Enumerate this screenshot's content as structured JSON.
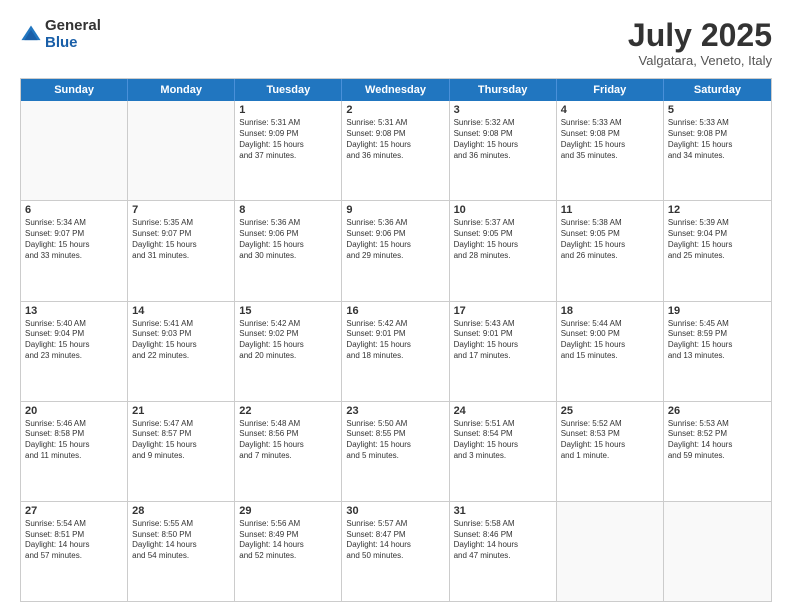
{
  "logo": {
    "general": "General",
    "blue": "Blue"
  },
  "title": "July 2025",
  "subtitle": "Valgatara, Veneto, Italy",
  "header": {
    "days": [
      "Sunday",
      "Monday",
      "Tuesday",
      "Wednesday",
      "Thursday",
      "Friday",
      "Saturday"
    ]
  },
  "weeks": [
    [
      {
        "day": "",
        "empty": true,
        "lines": []
      },
      {
        "day": "",
        "empty": true,
        "lines": []
      },
      {
        "day": "1",
        "empty": false,
        "lines": [
          "Sunrise: 5:31 AM",
          "Sunset: 9:09 PM",
          "Daylight: 15 hours",
          "and 37 minutes."
        ]
      },
      {
        "day": "2",
        "empty": false,
        "lines": [
          "Sunrise: 5:31 AM",
          "Sunset: 9:08 PM",
          "Daylight: 15 hours",
          "and 36 minutes."
        ]
      },
      {
        "day": "3",
        "empty": false,
        "lines": [
          "Sunrise: 5:32 AM",
          "Sunset: 9:08 PM",
          "Daylight: 15 hours",
          "and 36 minutes."
        ]
      },
      {
        "day": "4",
        "empty": false,
        "lines": [
          "Sunrise: 5:33 AM",
          "Sunset: 9:08 PM",
          "Daylight: 15 hours",
          "and 35 minutes."
        ]
      },
      {
        "day": "5",
        "empty": false,
        "lines": [
          "Sunrise: 5:33 AM",
          "Sunset: 9:08 PM",
          "Daylight: 15 hours",
          "and 34 minutes."
        ]
      }
    ],
    [
      {
        "day": "6",
        "empty": false,
        "lines": [
          "Sunrise: 5:34 AM",
          "Sunset: 9:07 PM",
          "Daylight: 15 hours",
          "and 33 minutes."
        ]
      },
      {
        "day": "7",
        "empty": false,
        "lines": [
          "Sunrise: 5:35 AM",
          "Sunset: 9:07 PM",
          "Daylight: 15 hours",
          "and 31 minutes."
        ]
      },
      {
        "day": "8",
        "empty": false,
        "lines": [
          "Sunrise: 5:36 AM",
          "Sunset: 9:06 PM",
          "Daylight: 15 hours",
          "and 30 minutes."
        ]
      },
      {
        "day": "9",
        "empty": false,
        "lines": [
          "Sunrise: 5:36 AM",
          "Sunset: 9:06 PM",
          "Daylight: 15 hours",
          "and 29 minutes."
        ]
      },
      {
        "day": "10",
        "empty": false,
        "lines": [
          "Sunrise: 5:37 AM",
          "Sunset: 9:05 PM",
          "Daylight: 15 hours",
          "and 28 minutes."
        ]
      },
      {
        "day": "11",
        "empty": false,
        "lines": [
          "Sunrise: 5:38 AM",
          "Sunset: 9:05 PM",
          "Daylight: 15 hours",
          "and 26 minutes."
        ]
      },
      {
        "day": "12",
        "empty": false,
        "lines": [
          "Sunrise: 5:39 AM",
          "Sunset: 9:04 PM",
          "Daylight: 15 hours",
          "and 25 minutes."
        ]
      }
    ],
    [
      {
        "day": "13",
        "empty": false,
        "lines": [
          "Sunrise: 5:40 AM",
          "Sunset: 9:04 PM",
          "Daylight: 15 hours",
          "and 23 minutes."
        ]
      },
      {
        "day": "14",
        "empty": false,
        "lines": [
          "Sunrise: 5:41 AM",
          "Sunset: 9:03 PM",
          "Daylight: 15 hours",
          "and 22 minutes."
        ]
      },
      {
        "day": "15",
        "empty": false,
        "lines": [
          "Sunrise: 5:42 AM",
          "Sunset: 9:02 PM",
          "Daylight: 15 hours",
          "and 20 minutes."
        ]
      },
      {
        "day": "16",
        "empty": false,
        "lines": [
          "Sunrise: 5:42 AM",
          "Sunset: 9:01 PM",
          "Daylight: 15 hours",
          "and 18 minutes."
        ]
      },
      {
        "day": "17",
        "empty": false,
        "lines": [
          "Sunrise: 5:43 AM",
          "Sunset: 9:01 PM",
          "Daylight: 15 hours",
          "and 17 minutes."
        ]
      },
      {
        "day": "18",
        "empty": false,
        "lines": [
          "Sunrise: 5:44 AM",
          "Sunset: 9:00 PM",
          "Daylight: 15 hours",
          "and 15 minutes."
        ]
      },
      {
        "day": "19",
        "empty": false,
        "lines": [
          "Sunrise: 5:45 AM",
          "Sunset: 8:59 PM",
          "Daylight: 15 hours",
          "and 13 minutes."
        ]
      }
    ],
    [
      {
        "day": "20",
        "empty": false,
        "lines": [
          "Sunrise: 5:46 AM",
          "Sunset: 8:58 PM",
          "Daylight: 15 hours",
          "and 11 minutes."
        ]
      },
      {
        "day": "21",
        "empty": false,
        "lines": [
          "Sunrise: 5:47 AM",
          "Sunset: 8:57 PM",
          "Daylight: 15 hours",
          "and 9 minutes."
        ]
      },
      {
        "day": "22",
        "empty": false,
        "lines": [
          "Sunrise: 5:48 AM",
          "Sunset: 8:56 PM",
          "Daylight: 15 hours",
          "and 7 minutes."
        ]
      },
      {
        "day": "23",
        "empty": false,
        "lines": [
          "Sunrise: 5:50 AM",
          "Sunset: 8:55 PM",
          "Daylight: 15 hours",
          "and 5 minutes."
        ]
      },
      {
        "day": "24",
        "empty": false,
        "lines": [
          "Sunrise: 5:51 AM",
          "Sunset: 8:54 PM",
          "Daylight: 15 hours",
          "and 3 minutes."
        ]
      },
      {
        "day": "25",
        "empty": false,
        "lines": [
          "Sunrise: 5:52 AM",
          "Sunset: 8:53 PM",
          "Daylight: 15 hours",
          "and 1 minute."
        ]
      },
      {
        "day": "26",
        "empty": false,
        "lines": [
          "Sunrise: 5:53 AM",
          "Sunset: 8:52 PM",
          "Daylight: 14 hours",
          "and 59 minutes."
        ]
      }
    ],
    [
      {
        "day": "27",
        "empty": false,
        "lines": [
          "Sunrise: 5:54 AM",
          "Sunset: 8:51 PM",
          "Daylight: 14 hours",
          "and 57 minutes."
        ]
      },
      {
        "day": "28",
        "empty": false,
        "lines": [
          "Sunrise: 5:55 AM",
          "Sunset: 8:50 PM",
          "Daylight: 14 hours",
          "and 54 minutes."
        ]
      },
      {
        "day": "29",
        "empty": false,
        "lines": [
          "Sunrise: 5:56 AM",
          "Sunset: 8:49 PM",
          "Daylight: 14 hours",
          "and 52 minutes."
        ]
      },
      {
        "day": "30",
        "empty": false,
        "lines": [
          "Sunrise: 5:57 AM",
          "Sunset: 8:47 PM",
          "Daylight: 14 hours",
          "and 50 minutes."
        ]
      },
      {
        "day": "31",
        "empty": false,
        "lines": [
          "Sunrise: 5:58 AM",
          "Sunset: 8:46 PM",
          "Daylight: 14 hours",
          "and 47 minutes."
        ]
      },
      {
        "day": "",
        "empty": true,
        "lines": []
      },
      {
        "day": "",
        "empty": true,
        "lines": []
      }
    ]
  ]
}
